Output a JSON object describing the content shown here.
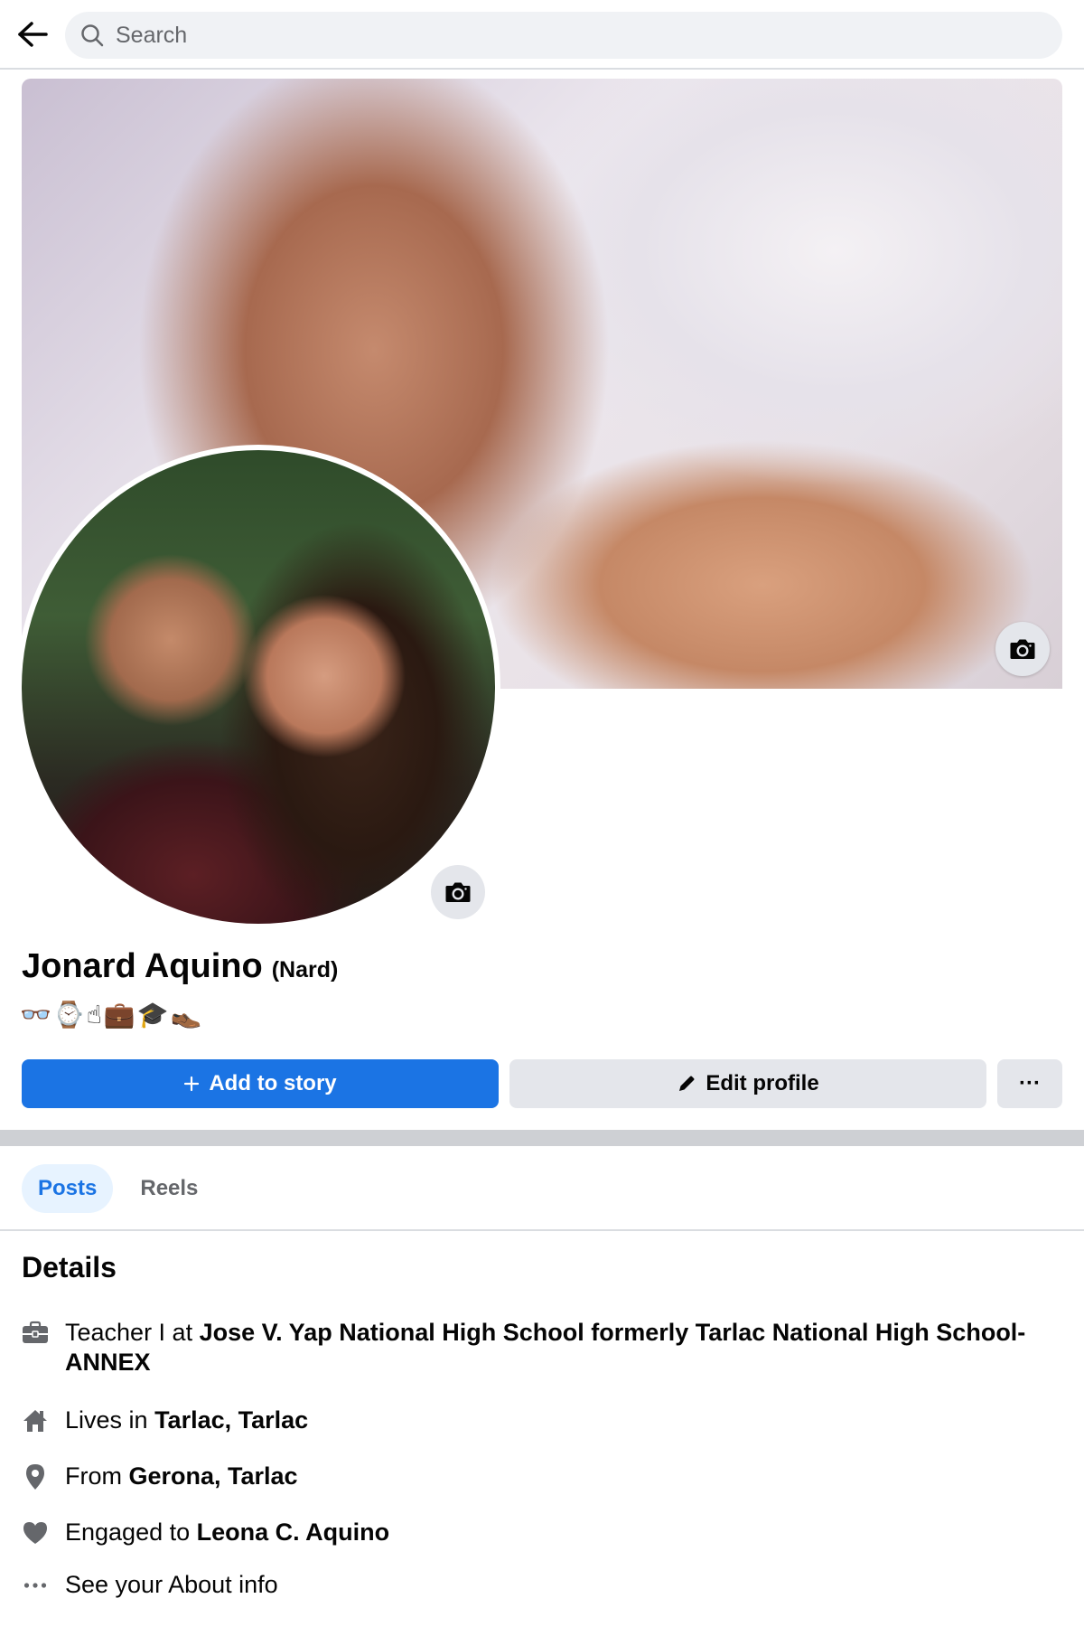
{
  "search": {
    "placeholder": "Search"
  },
  "icons": {
    "back": "arrow-left-icon",
    "search": "search-icon",
    "camera": "camera-icon",
    "plus": "plus-icon",
    "pencil": "pencil-icon",
    "more": "ellipsis-icon",
    "work": "briefcase-icon",
    "home": "house-icon",
    "from": "location-pin-icon",
    "relationship": "heart-icon",
    "about": "ellipsis-icon"
  },
  "colors": {
    "accent": "#1b74e4",
    "tab_active_bg": "#e7f3ff",
    "button_gray": "#e4e6eb",
    "text_secondary": "#65676b"
  },
  "profile": {
    "name": "Jonard Aquino",
    "nickname": "(Nard)",
    "bio": "👓⌚☝💼🎓👞"
  },
  "actions": {
    "add_story": "Add to story",
    "edit_profile": "Edit profile",
    "more": "···"
  },
  "tabs": [
    {
      "label": "Posts",
      "active": true
    },
    {
      "label": "Reels",
      "active": false
    }
  ],
  "details": {
    "title": "Details",
    "work": {
      "prefix": "Teacher I at ",
      "value": "Jose V. Yap National High School formerly Tarlac National High School-ANNEX"
    },
    "lives": {
      "prefix": "Lives in ",
      "value": "Tarlac, Tarlac"
    },
    "from": {
      "prefix": "From ",
      "value": "Gerona, Tarlac"
    },
    "relationship": {
      "prefix": "Engaged to ",
      "value": "Leona C. Aquino"
    },
    "about": {
      "label": "See your About info"
    }
  }
}
